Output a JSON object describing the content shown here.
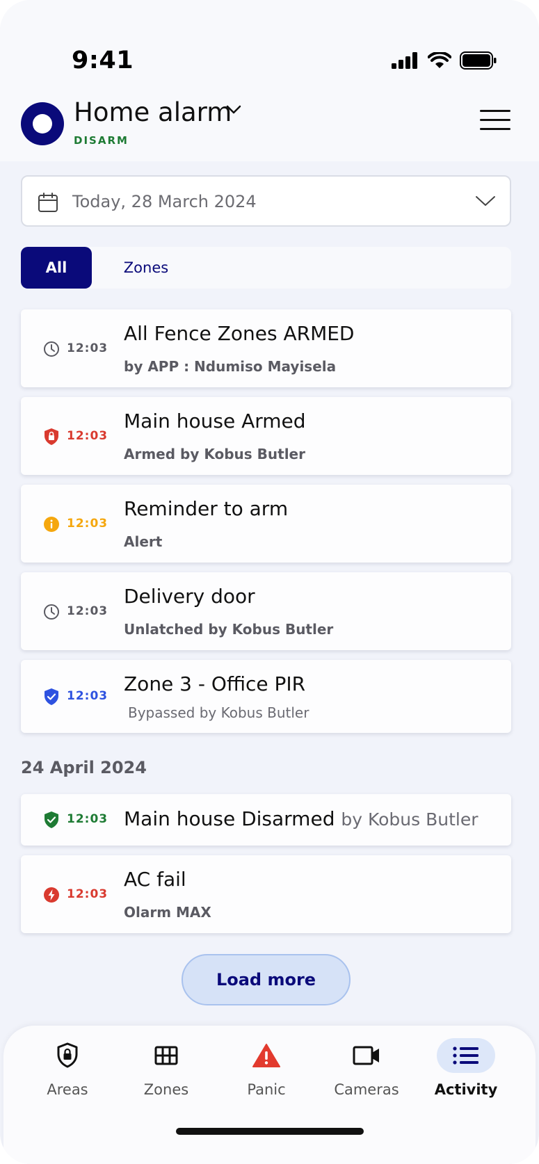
{
  "status_bar": {
    "time": "9:41"
  },
  "header": {
    "title": "Home alarm",
    "state": "DISARM"
  },
  "date_filter": {
    "label": "Today, 28 March 2024"
  },
  "tabs": [
    {
      "label": "All",
      "active": true
    },
    {
      "label": "Zones",
      "active": false
    }
  ],
  "events_today": [
    {
      "icon": "clock-icon",
      "time": "12:03",
      "time_color": "#5a5a62",
      "title": "All Fence Zones ARMED",
      "subtitle": "by APP : Ndumiso Mayisela"
    },
    {
      "icon": "lock-shield-icon",
      "time": "12:03",
      "time_color": "#d93a2f",
      "title": "Main house Armed",
      "subtitle": "Armed by Kobus Butler"
    },
    {
      "icon": "info-icon",
      "time": "12:03",
      "time_color": "#f5a70e",
      "title": "Reminder to arm",
      "subtitle": "Alert"
    },
    {
      "icon": "clock-icon",
      "time": "12:03",
      "time_color": "#5a5a62",
      "title": "Delivery door",
      "subtitle": "Unlatched by Kobus Butler"
    },
    {
      "icon": "shield-check-icon",
      "time": "12:03",
      "time_color": "#2e52e0",
      "title": "Zone 3 - Office PIR",
      "subtitle": "Bypassed by Kobus Butler"
    }
  ],
  "section_2": {
    "label": "24 April 2024"
  },
  "events_earlier": [
    {
      "icon": "shield-check-icon",
      "time": "12:03",
      "time_color": "#1e7b34",
      "title": "Main house Disarmed",
      "subtitle": "by Kobus Butler"
    },
    {
      "icon": "bolt-icon",
      "time": "12:03",
      "time_color": "#d93a2f",
      "title": "AC fail",
      "subtitle": "Olarm MAX"
    }
  ],
  "load_more": {
    "label": "Load more"
  },
  "nav": [
    {
      "label": "Areas",
      "icon": "shield-lock-icon"
    },
    {
      "label": "Zones",
      "icon": "grid-icon"
    },
    {
      "label": "Panic",
      "icon": "warning-icon"
    },
    {
      "label": "Cameras",
      "icon": "video-camera-icon"
    },
    {
      "label": "Activity",
      "icon": "list-icon",
      "active": true
    }
  ],
  "colors": {
    "brand": "#0a0a7a",
    "disarm_green": "#1e7b34",
    "alert_red": "#d93a2f",
    "warning_orange": "#f5a70e",
    "bypass_blue": "#2e52e0"
  }
}
